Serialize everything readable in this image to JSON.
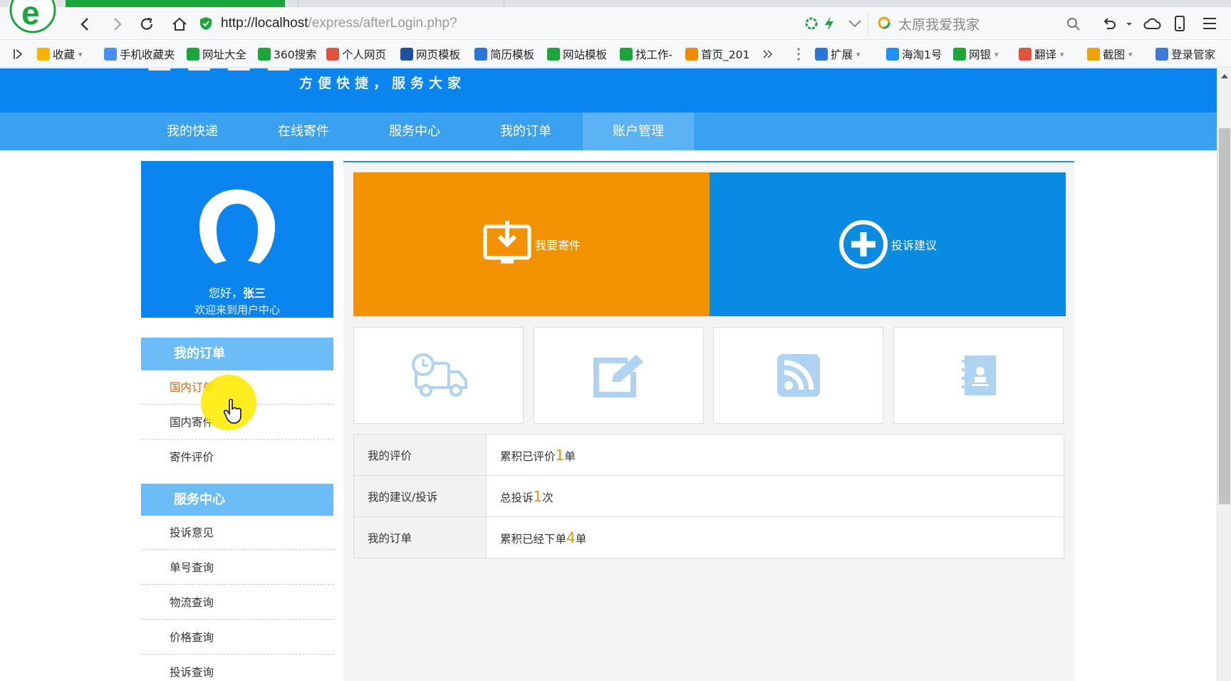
{
  "browser": {
    "url_host": "http://localhost",
    "url_path": "/express/afterLogin.php?",
    "search_text": "太原我爱我家",
    "bookmarks": [
      {
        "label": "收藏",
        "icon": "star-icon",
        "has_dropdown": true
      },
      {
        "label": "手机收藏夹",
        "icon": "phone-icon"
      },
      {
        "label": "网址大全",
        "icon": "globe-icon"
      },
      {
        "label": "360搜索",
        "icon": "search-360-icon"
      },
      {
        "label": "个人网页",
        "icon": "page-icon"
      },
      {
        "label": "网页模板",
        "icon": "template-icon"
      },
      {
        "label": "简历模板",
        "icon": "resume-icon"
      },
      {
        "label": "网站模板",
        "icon": "m-icon"
      },
      {
        "label": "找工作-",
        "icon": "l-icon"
      },
      {
        "label": "首页_201",
        "icon": "home-page-icon"
      }
    ],
    "extensions": [
      {
        "label": "扩展",
        "has_dropdown": true
      },
      {
        "label": "海淘1号"
      },
      {
        "label": "网银",
        "has_dropdown": true
      },
      {
        "label": "翻译",
        "has_dropdown": true
      },
      {
        "label": "截图",
        "has_dropdown": true
      },
      {
        "label": "登录管家"
      }
    ],
    "colors": {
      "tab_active": "#1aa63a",
      "chrome_bg": "#f7f8fa"
    }
  },
  "page": {
    "slogan": "方便快捷，服务大家",
    "nav": [
      "我的快递",
      "在线寄件",
      "服务中心",
      "我的订单",
      "账户管理"
    ],
    "nav_active_index": 4,
    "profile": {
      "greeting": "您好，",
      "username": "张三",
      "welcome": "欢迎来到用户中心"
    },
    "sidebar": {
      "sections": [
        {
          "title": "我的订单",
          "items": [
            "国内订单",
            "国内寄件",
            "寄件评价"
          ]
        },
        {
          "title": "服务中心",
          "items": [
            "投诉意见",
            "单号查询",
            "物流查询",
            "价格查询",
            "投诉查询"
          ]
        }
      ]
    },
    "tiles": {
      "send": {
        "label": "我要寄件",
        "icon": "download-monitor-icon",
        "color": "#f39200"
      },
      "complaint": {
        "label": "投诉建议",
        "icon": "plus-circle-icon",
        "color": "#0a8be3"
      },
      "small": [
        "delivery-truck-icon",
        "edit-icon",
        "rss-icon",
        "contact-book-icon"
      ]
    },
    "stats": [
      {
        "key": "我的评价",
        "prefix": "累积已评价",
        "value": "1",
        "suffix": "单"
      },
      {
        "key": "我的建议/投诉",
        "prefix": "总投诉",
        "value": "1",
        "suffix": "次"
      },
      {
        "key": "我的订单",
        "prefix": "累积已经下单",
        "value": "4",
        "suffix": "单"
      }
    ],
    "colors": {
      "banner": "#0a85f0",
      "nav": "#3aa0f0",
      "accent_number": "#f09000"
    }
  }
}
